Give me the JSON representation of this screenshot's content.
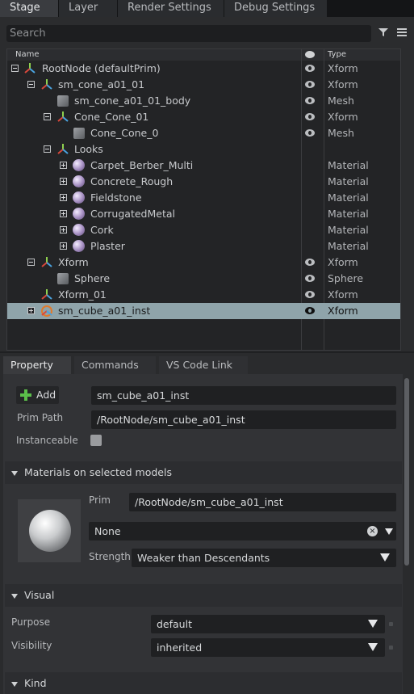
{
  "tabs": [
    "Stage",
    "Layer",
    "Render Settings",
    "Debug Settings"
  ],
  "search": {
    "placeholder": "Search"
  },
  "tree": {
    "col_name": "Name",
    "col_type": "Type",
    "rows": [
      {
        "name": "RootNode (defaultPrim)",
        "type": "Xform"
      },
      {
        "name": "sm_cone_a01_01",
        "type": "Xform"
      },
      {
        "name": "sm_cone_a01_01_body",
        "type": "Mesh"
      },
      {
        "name": "Cone_Cone_01",
        "type": "Xform"
      },
      {
        "name": "Cone_Cone_0",
        "type": "Mesh"
      },
      {
        "name": "Looks",
        "type": ""
      },
      {
        "name": "Carpet_Berber_Multi",
        "type": "Material"
      },
      {
        "name": "Concrete_Rough",
        "type": "Material"
      },
      {
        "name": "Fieldstone",
        "type": "Material"
      },
      {
        "name": "CorrugatedMetal",
        "type": "Material"
      },
      {
        "name": "Cork",
        "type": "Material"
      },
      {
        "name": "Plaster",
        "type": "Material"
      },
      {
        "name": "Xform",
        "type": "Xform"
      },
      {
        "name": "Sphere",
        "type": "Sphere"
      },
      {
        "name": "Xform_01",
        "type": "Xform"
      },
      {
        "name": "sm_cube_a01_inst",
        "type": "Xform"
      }
    ]
  },
  "panel_tabs": [
    "Property",
    "Commands",
    "VS Code Link"
  ],
  "property": {
    "add_label": "Add",
    "name_value": "sm_cube_a01_inst",
    "prim_path_label": "Prim Path",
    "prim_path_value": "/RootNode/sm_cube_a01_inst",
    "instanceable_label": "Instanceable"
  },
  "materials": {
    "header": "Materials on selected models",
    "prim_label": "Prim",
    "prim_value": "/RootNode/sm_cube_a01_inst",
    "material_value": "None",
    "strength_label": "Strength",
    "strength_value": "Weaker than Descendants"
  },
  "visual": {
    "header": "Visual",
    "purpose_label": "Purpose",
    "purpose_value": "default",
    "visibility_label": "Visibility",
    "visibility_value": "inherited"
  },
  "kind": {
    "header": "Kind"
  },
  "colors": {
    "selection": "#8fa4aa",
    "add_icon": "#5bbf4a",
    "xform_red": "#d9483b",
    "xform_blue": "#4aa3e0"
  }
}
